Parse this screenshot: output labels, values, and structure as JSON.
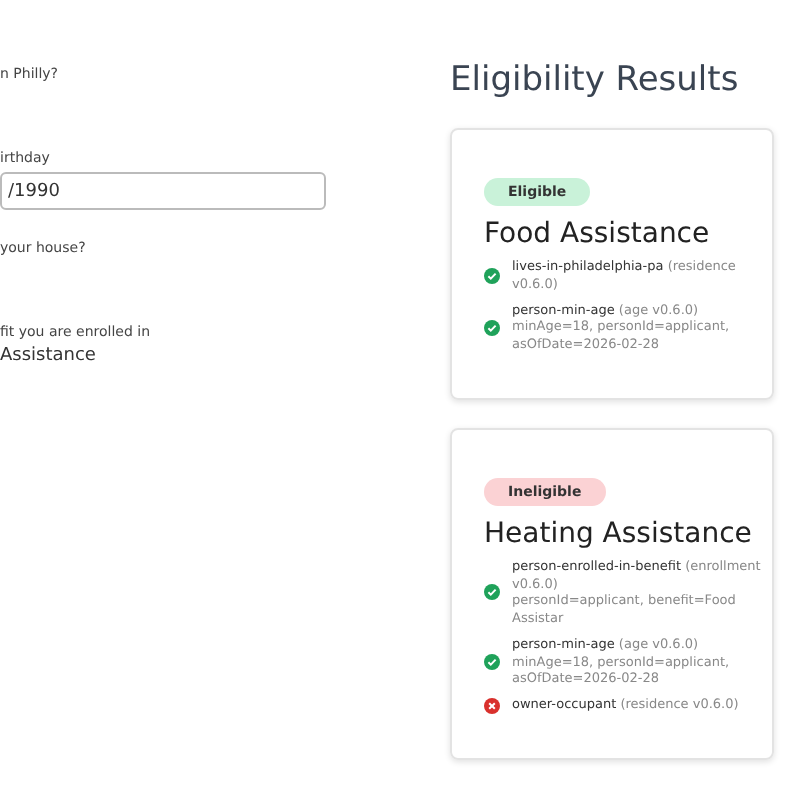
{
  "form": {
    "fields": [
      {
        "kind": "question",
        "label": "n Philly?"
      },
      {
        "kind": "text",
        "label": "irthday",
        "value": "/1990"
      },
      {
        "kind": "question",
        "label": "your house?"
      },
      {
        "kind": "answer",
        "label": "fit you are enrolled in",
        "value": "Assistance"
      }
    ]
  },
  "results": {
    "title": "Eligibility Results",
    "programs": [
      {
        "status": "Eligible",
        "eligible": true,
        "name": "Food Assistance",
        "rules": [
          {
            "name": "lives-in-philadelphia-pa",
            "source": "(residence v0.6.0)",
            "passed": true
          },
          {
            "name": "person-min-age",
            "source": "(age v0.6.0)",
            "params": "minAge=18, personId=applicant, asOfDate=2026-02-28",
            "passed": true
          }
        ]
      },
      {
        "status": "Ineligible",
        "eligible": false,
        "name": "Heating Assistance",
        "rules": [
          {
            "name": "person-enrolled-in-benefit",
            "source": "(enrollment v0.6.0)",
            "params": "personId=applicant, benefit=Food Assistar",
            "passed": true
          },
          {
            "name": "person-min-age",
            "source": "(age v0.6.0)",
            "params": "minAge=18, personId=applicant, asOfDate=2026-02-28",
            "passed": true
          },
          {
            "name": "owner-occupant",
            "source": "(residence v0.6.0)",
            "passed": false
          }
        ]
      }
    ]
  }
}
